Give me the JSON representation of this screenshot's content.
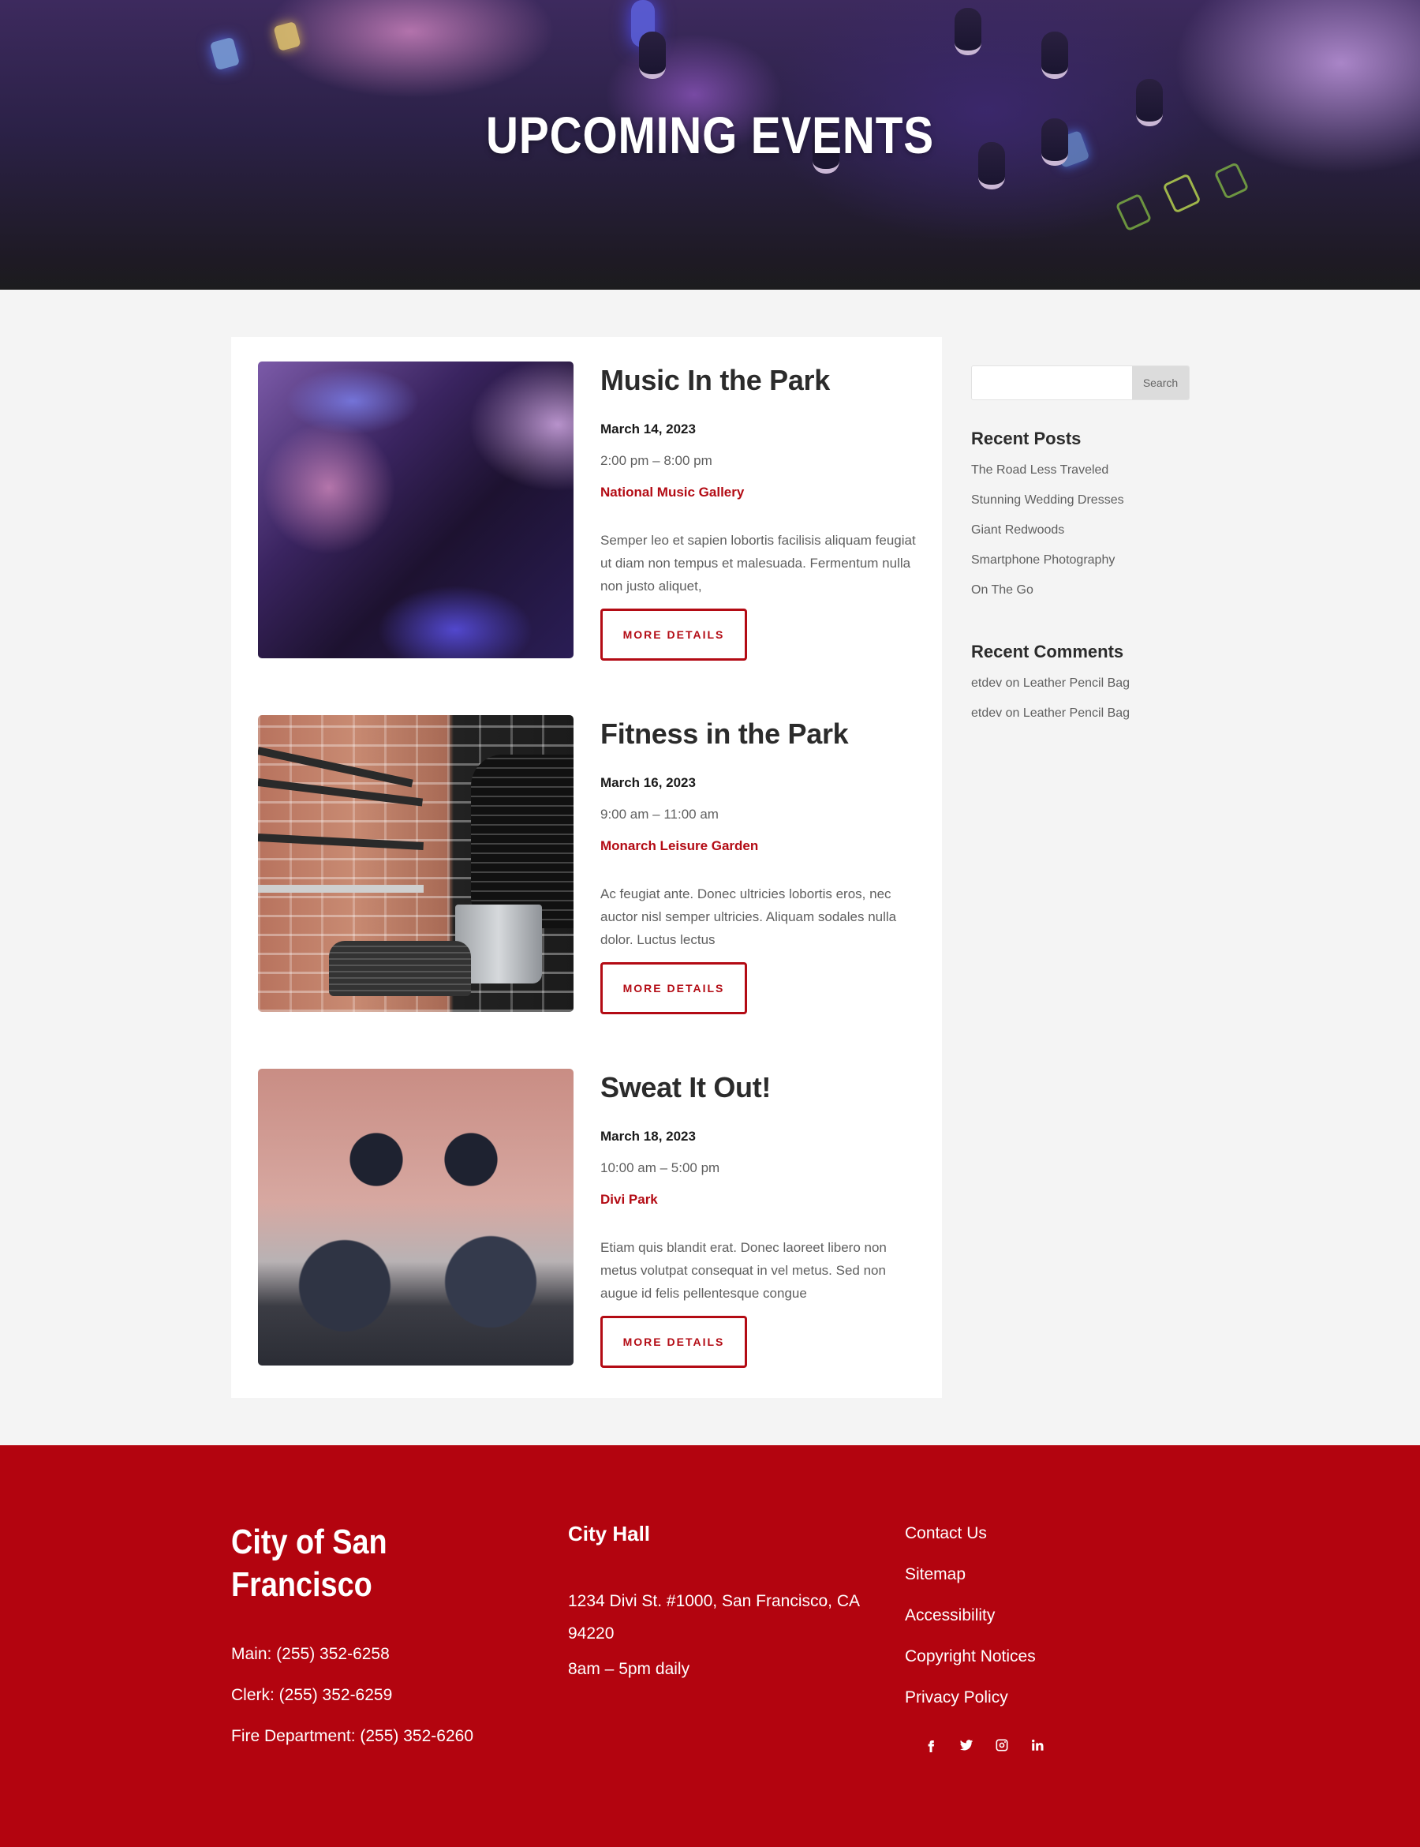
{
  "hero": {
    "title": "UPCOMING EVENTS"
  },
  "events": [
    {
      "title": "Music In the Park",
      "date": "March 14, 2023",
      "time": "2:00 pm – 8:00 pm",
      "venue": "National Music Gallery",
      "description": "Semper leo et sapien lobortis facilisis aliquam feugiat ut diam non tempus et malesuada. Fermentum nulla non justo aliquet,",
      "button_label": "MORE DETAILS",
      "image": "dj-mixer-photo"
    },
    {
      "title": "Fitness in the Park",
      "date": "March 16, 2023",
      "time": "9:00 am – 11:00 am",
      "venue": "Monarch Leisure Garden",
      "description": "Ac feugiat ante. Donec ultricies lobortis eros, nec auctor nisl semper ultricies. Aliquam sodales nulla dolor. Luctus lectus",
      "button_label": "MORE DETAILS",
      "image": "barbell-rack-photo"
    },
    {
      "title": "Sweat It Out!",
      "date": "March 18, 2023",
      "time": "10:00 am – 5:00 pm",
      "venue": "Divi Park",
      "description": "Etiam quis blandit erat. Donec laoreet libero non metus volutpat consequat in vel metus. Sed non augue id felis pellentesque congue",
      "button_label": "MORE DETAILS",
      "image": "medicine-balls-photo"
    }
  ],
  "sidebar": {
    "search": {
      "value": "",
      "placeholder": "",
      "button_label": "Search"
    },
    "recent_posts": {
      "title": "Recent Posts",
      "items": [
        "The Road Less Traveled",
        "Stunning Wedding Dresses",
        "Giant Redwoods",
        "Smartphone Photography",
        "On The Go"
      ]
    },
    "recent_comments": {
      "title": "Recent Comments",
      "items": [
        {
          "author": "etdev",
          "connector": "on",
          "post": "Leather Pencil Bag"
        },
        {
          "author": "etdev",
          "connector": "on",
          "post": "Leather Pencil Bag"
        }
      ]
    }
  },
  "footer": {
    "brand": "City of San Francisco",
    "phones": [
      "Main: (255) 352-6258",
      "Clerk: (255) 352-6259",
      "Fire Department: (255) 352-6260"
    ],
    "city_hall": {
      "title": "City Hall",
      "address": "1234 Divi St. #1000, San Francisco, CA 94220",
      "hours": "8am – 5pm daily"
    },
    "links": [
      "Contact Us",
      "Sitemap",
      "Accessibility",
      "Copyright Notices",
      "Privacy Policy"
    ],
    "socials": [
      "facebook",
      "twitter",
      "instagram",
      "linkedin"
    ]
  },
  "colors": {
    "accent": "#b30b14",
    "footer_bg": "#b3040f",
    "page_bg": "#f4f4f4",
    "card_bg": "#ffffff",
    "heading": "#2b2b2b",
    "body_text": "#5f5f5f"
  }
}
